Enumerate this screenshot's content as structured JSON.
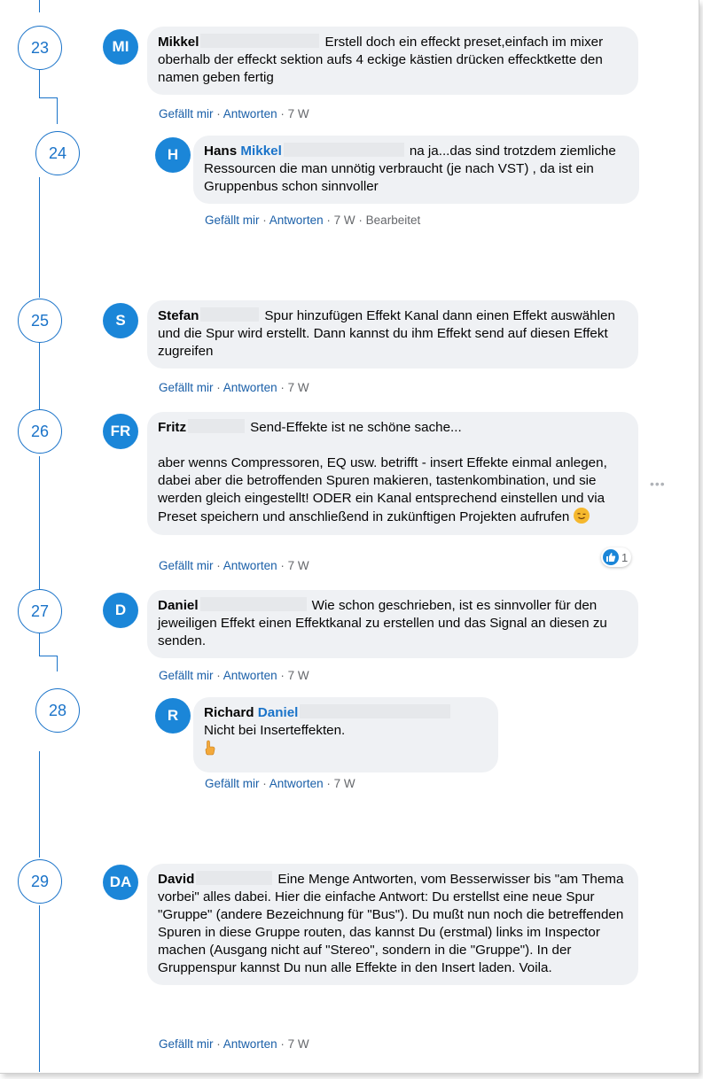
{
  "numbers": [
    "23",
    "24",
    "25",
    "26",
    "27",
    "28",
    "29"
  ],
  "actions": {
    "like": "Gefällt mir",
    "reply": "Antworten",
    "separator": "·",
    "edited": "Bearbeitet"
  },
  "comments": [
    {
      "initials": "MI",
      "author": "Mikkel",
      "text_first": "Erstell doch ein effeckt preset,einfach im mixer",
      "text_rest": "oberhalb der effeckt sektion aufs 4 eckige kästien drücken effecktkette den namen geben fertig",
      "time": "7 W"
    },
    {
      "initials": "H",
      "author": "Hans",
      "mention": "Mikkel",
      "text_first": "na ja...das sind trotzdem",
      "text_rest": "ziemliche Ressourcen die man unnötig verbraucht (je nach VST) , da ist ein Gruppenbus schon sinnvoller",
      "time": "7 W",
      "edited": true
    },
    {
      "initials": "S",
      "author": "Stefan",
      "text_first": "Spur hinzufügen Effekt Kanal dann einen Effekt",
      "text_rest": "auswählen und die Spur wird erstellt. Dann kannst du ihm Effekt send auf diesen Effekt zugreifen",
      "time": "7 W"
    },
    {
      "initials": "FR",
      "author": "Fritz",
      "text_first": "Send-Effekte ist ne schöne sache...",
      "text_rest": "aber wenns Compressoren, EQ usw. betrifft - insert Effekte einmal anlegen, dabei aber die betroffenden Spuren makieren, tastenkombination, und sie werden gleich eingestellt! ODER ein Kanal entsprechend einstellen und via Preset speichern und anschließend in zukünftigen Projekten aufrufen",
      "emoji": "wink-emoji",
      "reaction_count": "1",
      "time": "7 W"
    },
    {
      "initials": "D",
      "author": "Daniel",
      "text_first": "Wie schon geschrieben, ist es sinnvoller",
      "text_rest": "für den jeweiligen Effekt einen Effektkanal zu erstellen und das Signal an diesen zu senden.",
      "time": "7 W"
    },
    {
      "initials": "R",
      "author": "Richard",
      "mention": "Daniel",
      "text_rest": "Nicht bei Inserteffekten.",
      "emoji": "pointing-hand-emoji",
      "time": "7 W"
    },
    {
      "initials": "DA",
      "author": "David",
      "text_first": "Eine Menge Antworten, vom Besserwisser bis",
      "text_rest": "\"am Thema vorbei\" alles dabei. Hier die einfache Antwort: Du erstellst eine neue Spur \"Gruppe\" (andere Bezeichnung für \"Bus\"). Du mußt nun noch die betreffenden Spuren in diese Gruppe routen, das kannst Du (erstmal) links im Inspector machen (Ausgang nicht auf \"Stereo\", sondern in die \"Gruppe\"). In der Gruppenspur kannst Du nun alle Effekte in den Insert laden. Voila.",
      "time": "7 W"
    }
  ],
  "colors": {
    "accent": "#1a73c9",
    "avatar": "#1b86d8",
    "bubble": "#eff1f4",
    "meta": "#65676b"
  }
}
